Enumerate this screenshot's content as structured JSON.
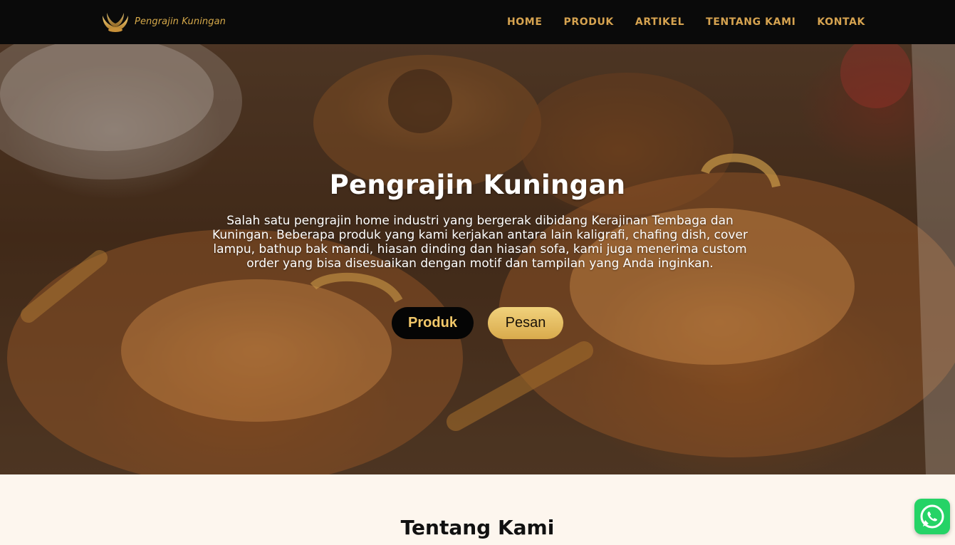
{
  "header": {
    "logo_text": "Pengrajin Kuningan",
    "nav": [
      {
        "label": "HOME"
      },
      {
        "label": "PRODUK"
      },
      {
        "label": "ARTIKEL"
      },
      {
        "label": "TENTANG KAMI"
      },
      {
        "label": "KONTAK"
      }
    ]
  },
  "hero": {
    "title": "Pengrajin Kuningan",
    "description": "Salah satu pengrajin home industri yang bergerak dibidang Kerajinan Tembaga dan Kuningan. Beberapa produk yang kami kerjakan antara lain kaligrafi, chafing dish, cover lampu, bathup bak mandi, hiasan dinding dan hiasan sofa, kami juga menerima custom order yang bisa disesuaikan dengan motif dan tampilan yang Anda inginkan.",
    "buttons": {
      "primary": "Produk",
      "secondary": "Pesan"
    }
  },
  "about": {
    "title": "Tentang Kami"
  },
  "floating": {
    "whatsapp_icon": "whatsapp-icon"
  },
  "colors": {
    "header_bg": "#0a0a0a",
    "nav_text": "#d6a350",
    "gold": "#d9aa4c",
    "section_bg": "#fdf6ee",
    "whatsapp": "#25d366"
  }
}
